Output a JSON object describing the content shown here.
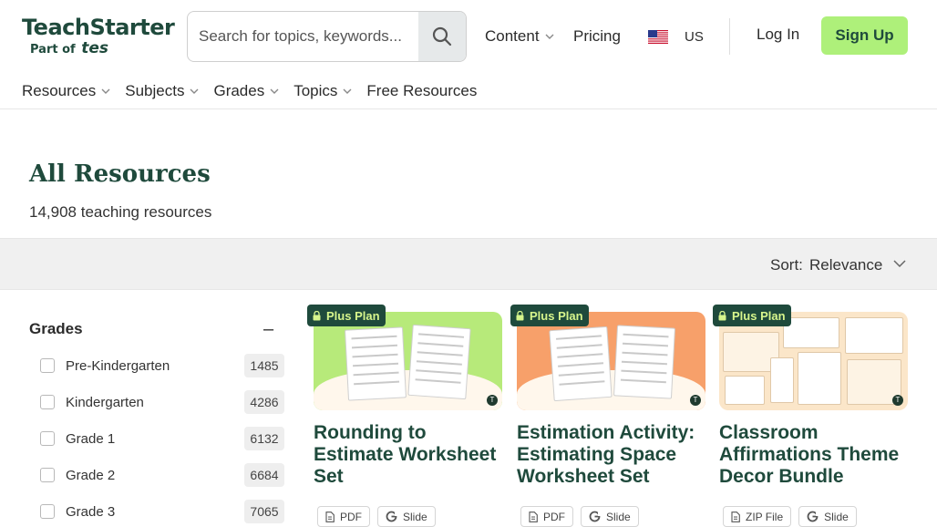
{
  "header": {
    "logo": {
      "main": "TeachStarter",
      "sub": "Part of",
      "sub_brand": "tes"
    },
    "search": {
      "placeholder": "Search for topics, keywords...",
      "value": ""
    },
    "nav": {
      "content": "Content",
      "pricing": "Pricing",
      "region": "US"
    },
    "login": "Log In",
    "signup": "Sign Up"
  },
  "main_nav": {
    "items": [
      {
        "label": "Resources",
        "has_menu": true
      },
      {
        "label": "Subjects",
        "has_menu": true
      },
      {
        "label": "Grades",
        "has_menu": true
      },
      {
        "label": "Topics",
        "has_menu": true
      },
      {
        "label": "Free Resources",
        "has_menu": false
      }
    ]
  },
  "page": {
    "title": "All Resources",
    "count": "14,908 teaching resources"
  },
  "sort": {
    "label": "Sort:",
    "value": "Relevance"
  },
  "filters": {
    "heading": "Grades",
    "collapse_symbol": "–",
    "items": [
      {
        "label": "Pre-Kindergarten",
        "count": "1485"
      },
      {
        "label": "Kindergarten",
        "count": "4286"
      },
      {
        "label": "Grade 1",
        "count": "6132"
      },
      {
        "label": "Grade 2",
        "count": "6684"
      },
      {
        "label": "Grade 3",
        "count": "7065"
      }
    ]
  },
  "cards": [
    {
      "badge": "Plus Plan",
      "title": "Rounding to Estimate Worksheet Set",
      "formats": [
        "PDF",
        "Slide"
      ],
      "thumb_color": "#b7ea7a"
    },
    {
      "badge": "Plus Plan",
      "title": "Estimation Activity: Estimating Space Worksheet Set",
      "formats": [
        "PDF",
        "Slide"
      ],
      "thumb_color": "#f7a06a"
    },
    {
      "badge": "Plus Plan",
      "title": "Classroom Affirmations Theme Decor Bundle",
      "formats": [
        "ZIP File",
        "Slide"
      ],
      "thumb_color": "#fbe6c9"
    }
  ],
  "colors": {
    "brand_green": "#1f4a3c",
    "signup_bg": "#aef07a",
    "badge_text": "#d7f58c"
  }
}
